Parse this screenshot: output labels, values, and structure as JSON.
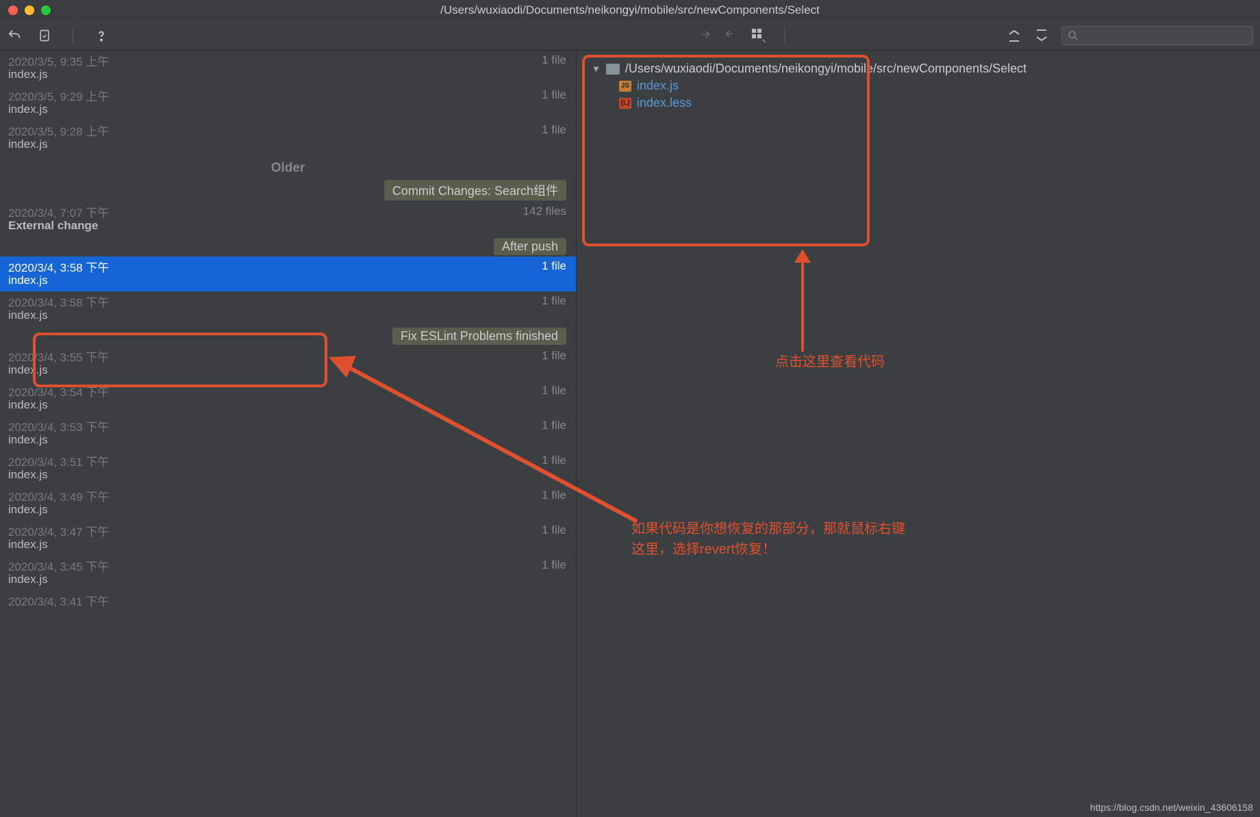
{
  "window": {
    "title": "/Users/wuxiaodi/Documents/neikongyi/mobile/src/newComponents/Select"
  },
  "toolbar": {
    "search_placeholder": ""
  },
  "history": {
    "top": [
      {
        "date": "2020/3/5, 9:35 上午",
        "name": "index.js",
        "files": "1 file"
      },
      {
        "date": "2020/3/5, 9:29 上午",
        "name": "index.js",
        "files": "1 file"
      },
      {
        "date": "2020/3/5, 9:28 上午",
        "name": "index.js",
        "files": "1 file"
      }
    ],
    "older_label": "Older",
    "commit_badge": "Commit Changes: Search组件",
    "external_entry": {
      "date": "2020/3/4, 7:07 下午",
      "name": "External change",
      "files": "142 files"
    },
    "after_push_badge": "After push",
    "selected": {
      "date": "2020/3/4, 3:58 下午",
      "name": "index.js",
      "files": "1 file"
    },
    "after_selected": {
      "date": "2020/3/4, 3:58 下午",
      "name": "index.js",
      "files": "1 file"
    },
    "fix_badge": "Fix ESLint Problems finished",
    "rest": [
      {
        "date": "2020/3/4, 3:55 下午",
        "name": "index.js",
        "files": "1 file"
      },
      {
        "date": "2020/3/4, 3:54 下午",
        "name": "index.js",
        "files": "1 file"
      },
      {
        "date": "2020/3/4, 3:53 下午",
        "name": "index.js",
        "files": "1 file"
      },
      {
        "date": "2020/3/4, 3:51 下午",
        "name": "index.js",
        "files": "1 file"
      },
      {
        "date": "2020/3/4, 3:49 下午",
        "name": "index.js",
        "files": "1 file"
      },
      {
        "date": "2020/3/4, 3:47 下午",
        "name": "index.js",
        "files": "1 file"
      },
      {
        "date": "2020/3/4, 3:45 下午",
        "name": "index.js",
        "files": "1 file"
      },
      {
        "date": "2020/3/4, 3:41 下午",
        "name": "",
        "files": ""
      }
    ]
  },
  "tree": {
    "root": "/Users/wuxiaodi/Documents/neikongyi/mobile/src/newComponents/Select",
    "files": [
      {
        "name": "index.js",
        "icon": "js"
      },
      {
        "name": "index.less",
        "icon": "less"
      }
    ]
  },
  "annotations": {
    "text1": "点击这里查看代码",
    "text2_line1": "如果代码是你想恢复的那部分，那就鼠标右键",
    "text2_line2": "这里，选择revert恢复！"
  },
  "watermark": "https://blog.csdn.net/weixin_43606158"
}
